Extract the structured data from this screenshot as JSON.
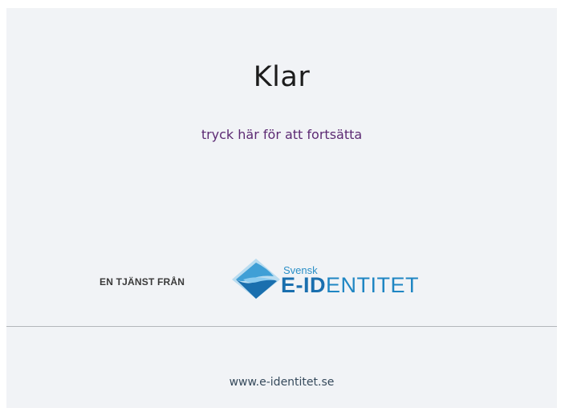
{
  "status": {
    "title": "Klar",
    "continue_link": "tryck här för att fortsätta"
  },
  "service": {
    "label": "EN TJÄNST FRÅN",
    "logo_small_text": "Svensk",
    "logo_bold_text": "E-ID",
    "logo_light_text": "ENTITET",
    "logo_icon": "e-identitet-logo-icon"
  },
  "footer": {
    "url_text": "www.e-identitet.se"
  },
  "colors": {
    "panel_background": "#f1f3f6",
    "link": "#5c2a73",
    "brand_blue": "#1a6fae",
    "brand_light_blue": "#2a8fc7"
  }
}
